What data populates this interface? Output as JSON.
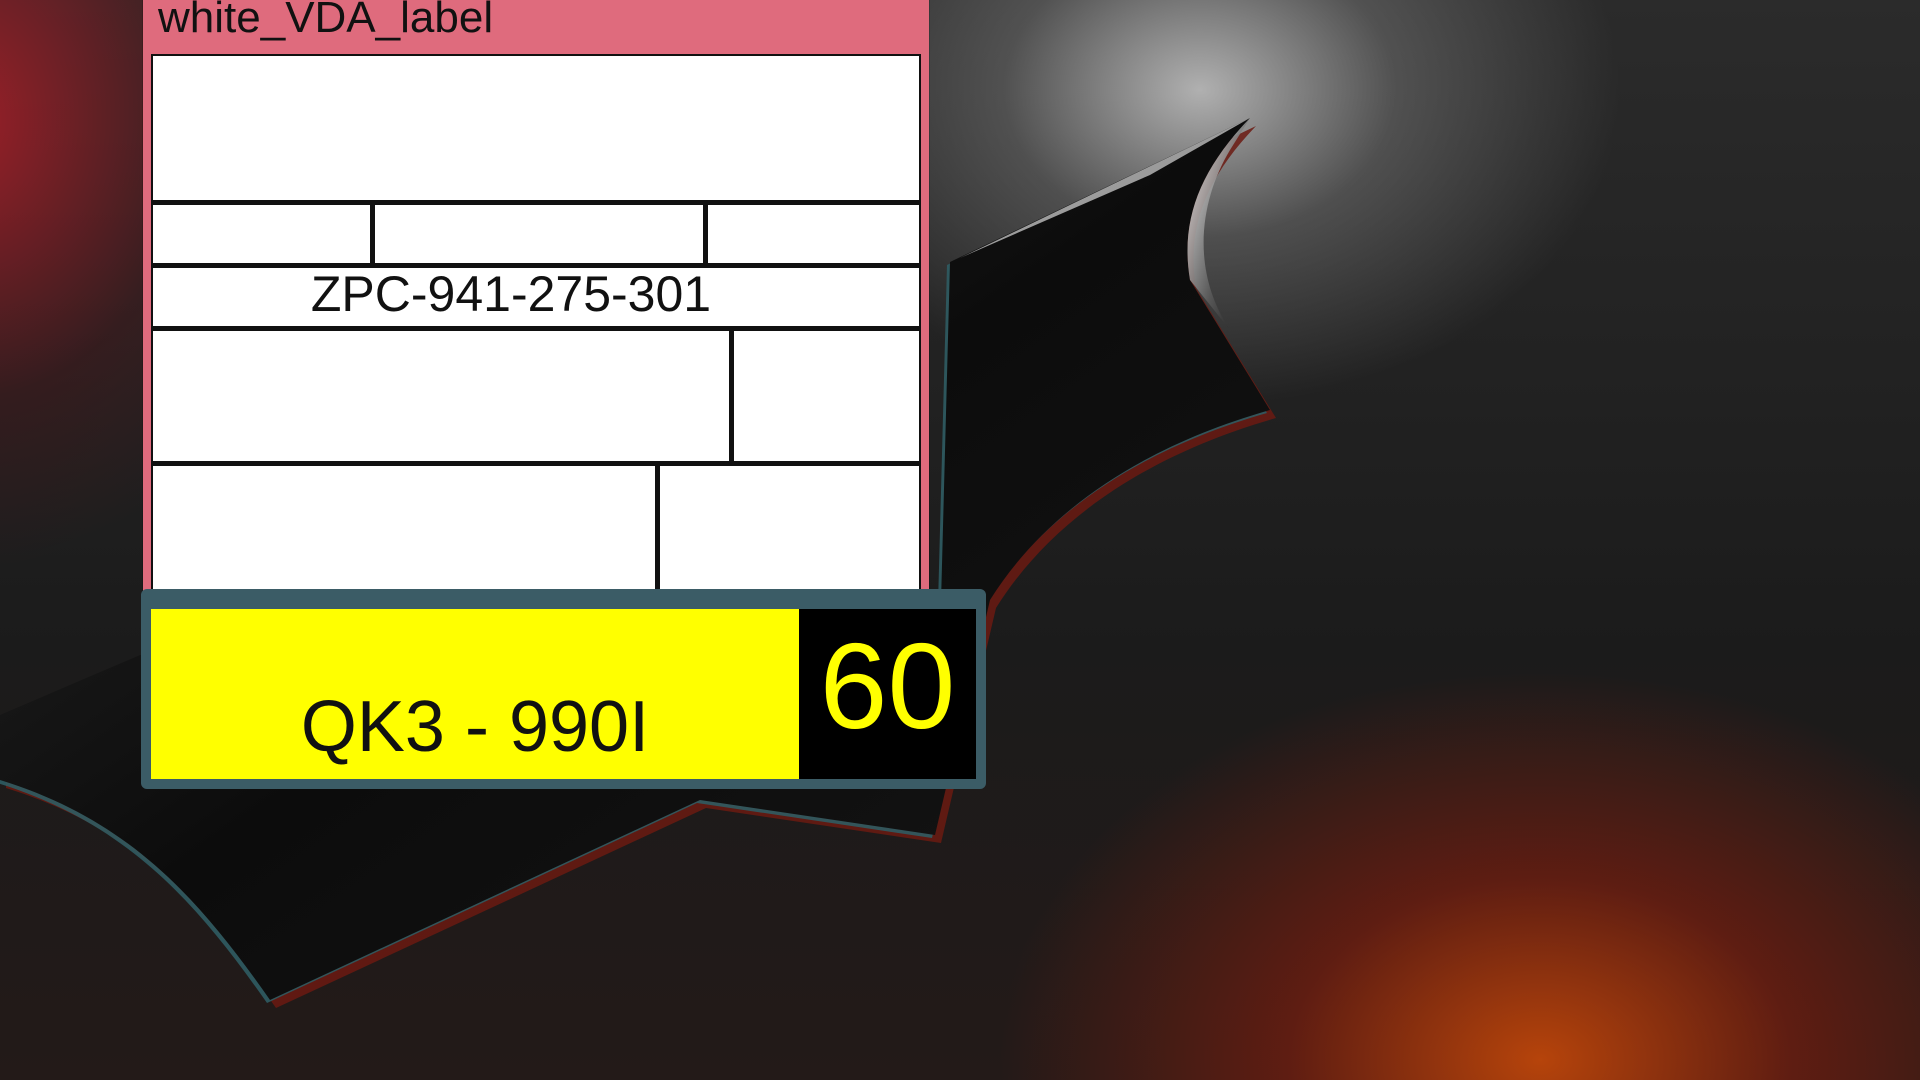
{
  "window": {
    "title": "white_VDA_label"
  },
  "label": {
    "part_number": "ZPC-941-275-301"
  },
  "plate": {
    "code": "QK3 - 990I",
    "number": "60"
  },
  "colors": {
    "window_frame": "#df6b7d",
    "plate_frame": "#3b5c66",
    "plate_yellow": "#ffff00",
    "plate_black": "#000000"
  },
  "icons": {
    "background": "bat-logo-wallpaper"
  }
}
